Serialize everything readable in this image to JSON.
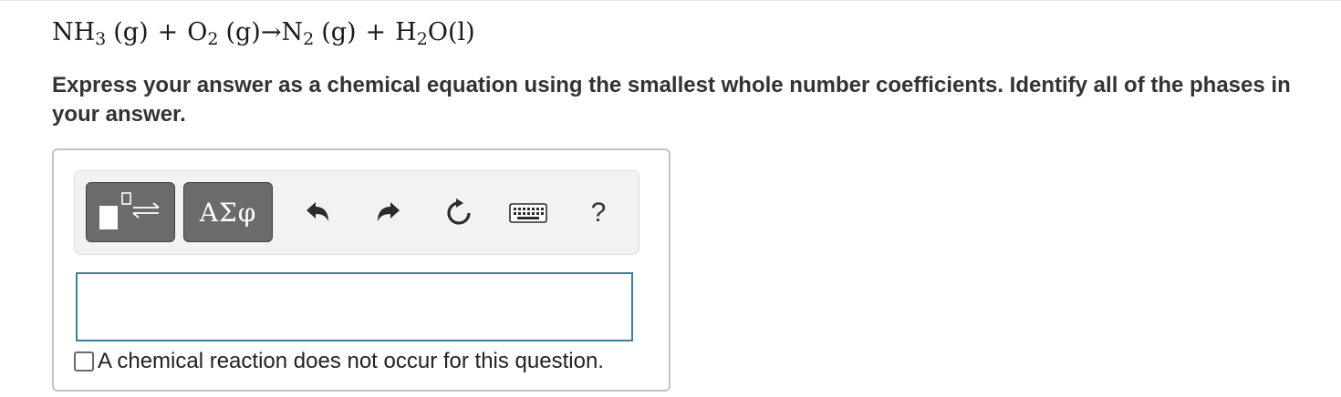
{
  "equation": {
    "t1": "NH",
    "t1_sub": "3",
    "t1_phase": "(g)",
    "op1": "+",
    "t2": "O",
    "t2_sub": "2",
    "t2_phase": "(g)",
    "arrow": "→",
    "t3": "N",
    "t3_sub": "2",
    "t3_phase": "(g)",
    "op2": "+",
    "t4a": "H",
    "t4_sub": "2",
    "t4b": "O",
    "t4_phase": "(l)"
  },
  "instruction": "Express your answer as a chemical equation using the smallest whole number coefficients. Identify all of the phases in your answer.",
  "toolbar": {
    "symbols_label": "ΑΣφ",
    "help_label": "?",
    "icons": [
      "templates-icon",
      "undo-icon",
      "redo-icon",
      "reset-icon",
      "keyboard-icon"
    ]
  },
  "answer": {
    "value": ""
  },
  "no_reaction": {
    "label": "A chemical reaction does not occur for this question.",
    "checked": false
  },
  "colors": {
    "button_bg": "#6b6b6b",
    "input_border": "#3e7d98",
    "panel_border": "#c4c4c4"
  }
}
